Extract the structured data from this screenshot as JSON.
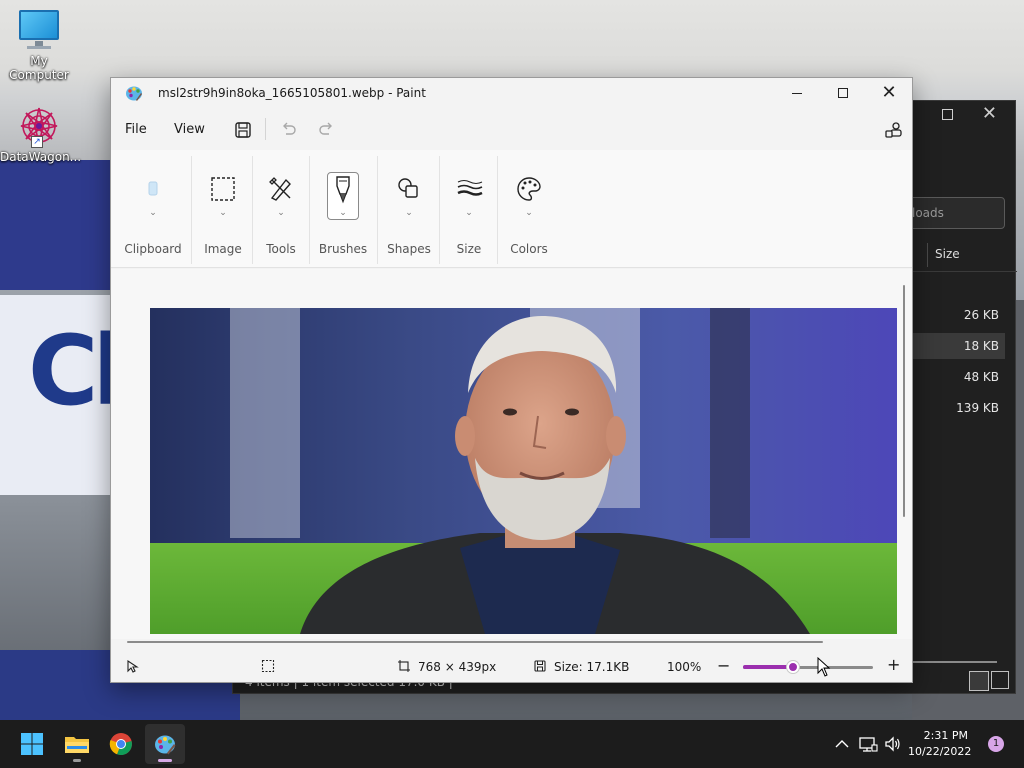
{
  "desktop": {
    "icons": [
      {
        "label": "My Computer",
        "icon": "computer-icon"
      },
      {
        "label": "DataWagon...",
        "icon": "datawagon-icon"
      }
    ],
    "wallpaper_text": "Clu"
  },
  "explorer_bg": {
    "search_placeholder": "loads",
    "column_size": "Size",
    "rows": [
      {
        "size": "26 KB",
        "selected": false
      },
      {
        "size": "18 KB",
        "selected": true
      },
      {
        "size": "48 KB",
        "selected": false
      },
      {
        "size": "139 KB",
        "selected": false
      }
    ],
    "status": "4 items  |  1 item selected  17.0 KB  |"
  },
  "paint": {
    "title": "msl2str9h9in8oka_1665105801.webp - Paint",
    "menu": {
      "file": "File",
      "view": "View"
    },
    "toolbar_icons": [
      "save-icon",
      "undo-icon",
      "redo-icon",
      "account-icon"
    ],
    "ribbon": {
      "groups": [
        {
          "label": "Clipboard",
          "icon": "clipboard-icon"
        },
        {
          "label": "Image",
          "icon": "selection-icon"
        },
        {
          "label": "Tools",
          "icon": "tools-icon"
        },
        {
          "label": "Brushes",
          "icon": "brush-icon"
        },
        {
          "label": "Shapes",
          "icon": "shapes-icon"
        },
        {
          "label": "Size",
          "icon": "size-icon"
        },
        {
          "label": "Colors",
          "icon": "palette-icon"
        }
      ]
    },
    "status": {
      "dimensions": "768 × 439px",
      "file_size": "Size: 17.1KB",
      "zoom": "100%",
      "zoom_level_fraction": 0.38
    }
  },
  "taskbar": {
    "apps": [
      "start-icon",
      "file-explorer-icon",
      "chrome-icon",
      "paint-icon"
    ],
    "time": "2:31 PM",
    "date": "10/22/2022",
    "notifications": "1"
  },
  "colors": {
    "accent": "#9b2fae",
    "taskbar": "#1c1c1c",
    "window": "#f3f3f3"
  }
}
